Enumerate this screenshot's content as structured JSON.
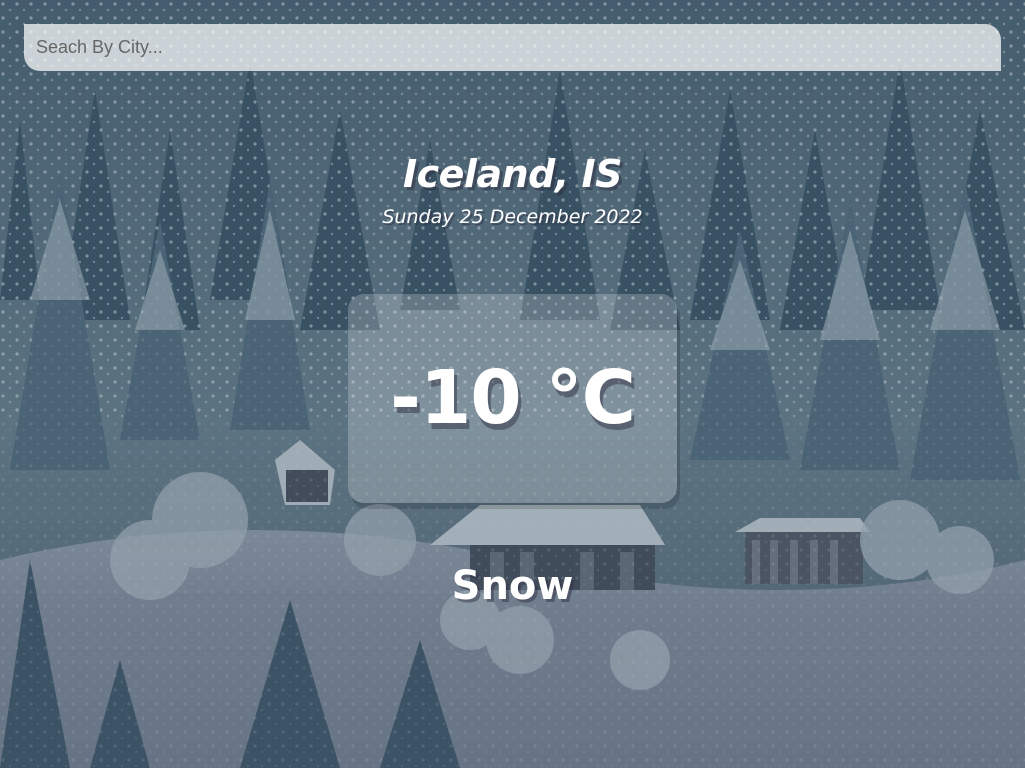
{
  "search": {
    "placeholder": "Seach By City...",
    "value": ""
  },
  "location": {
    "city_country": "Iceland, IS",
    "date": "Sunday 25 December 2022"
  },
  "weather": {
    "temperature": "-10 °C",
    "condition": "Snow"
  },
  "background": {
    "theme": "snowy-forest-with-cabins",
    "tint": "#2c4456"
  }
}
